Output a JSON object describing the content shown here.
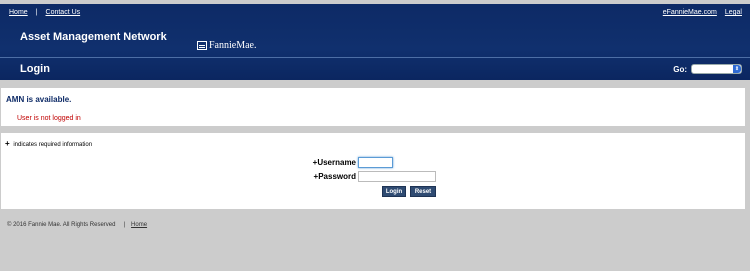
{
  "header": {
    "top_links": {
      "home": "Home",
      "separator": "|",
      "contact": "Contact Us"
    },
    "right_links": {
      "efanniemae": "eFannieMae.com",
      "legal": "Legal"
    },
    "app_title": "Asset Management Network",
    "logo_text": "FannieMae.",
    "page_title": "Login",
    "go_label": "Go:",
    "go_selected": ""
  },
  "status": {
    "title": "AMN is available.",
    "message": "User is not logged in"
  },
  "form": {
    "required_plus": "+",
    "required_note": "indicates required information",
    "username_label": "+Username",
    "password_label": "+Password",
    "username_value": "",
    "password_value": "",
    "login_button": "Login",
    "reset_button": "Reset"
  },
  "footer": {
    "copyright": "© 2016 Fannie Mae. All Rights Reserved",
    "separator": "|",
    "home_link": "Home"
  },
  "colors": {
    "header_bg": "#0d2a66",
    "error_text": "#c00000",
    "button_bg": "#2f4b72"
  }
}
